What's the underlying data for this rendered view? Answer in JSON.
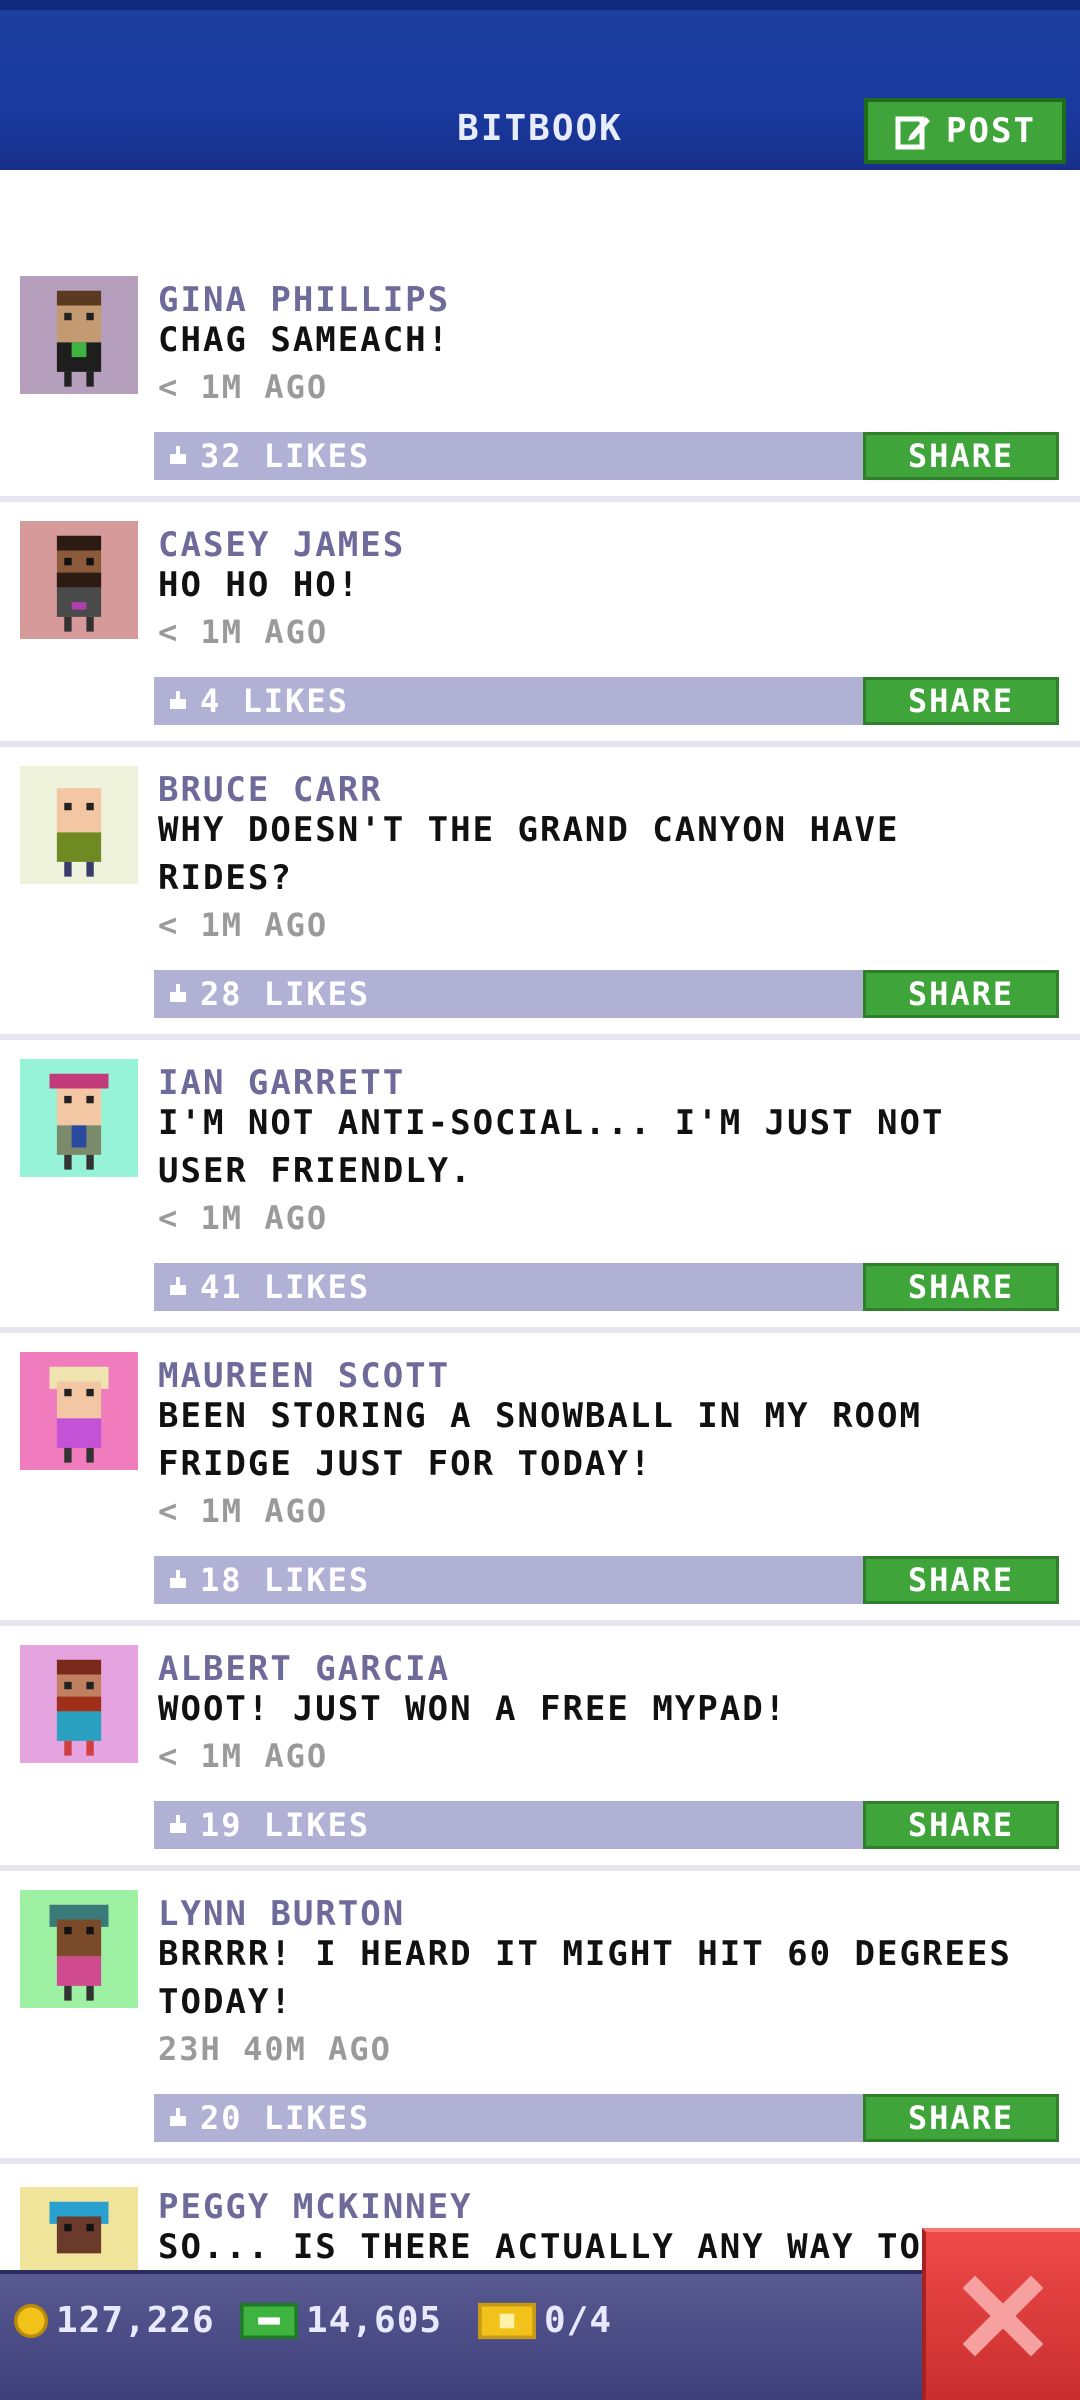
{
  "header": {
    "title": "BITBOOK",
    "post_label": "POST"
  },
  "posts": [
    {
      "name": "GINA PHILLIPS",
      "text": "CHAG SAMEACH!",
      "time": "< 1M AGO",
      "likes": "32 LIKES",
      "share": "SHARE",
      "avatar_bg": "#b59fbd"
    },
    {
      "name": "CASEY JAMES",
      "text": "HO HO HO!",
      "time": "< 1M AGO",
      "likes": "4 LIKES",
      "share": "SHARE",
      "avatar_bg": "#d79a9a"
    },
    {
      "name": "BRUCE CARR",
      "text": "WHY DOESN'T THE GRAND CANYON HAVE RIDES?",
      "time": "< 1M AGO",
      "likes": "28 LIKES",
      "share": "SHARE",
      "avatar_bg": "#eef2db"
    },
    {
      "name": "IAN GARRETT",
      "text": "I'M NOT ANTI-SOCIAL... I'M JUST NOT USER FRIENDLY.",
      "time": "< 1M AGO",
      "likes": "41 LIKES",
      "share": "SHARE",
      "avatar_bg": "#97f3d7"
    },
    {
      "name": "MAUREEN SCOTT",
      "text": "BEEN STORING A SNOWBALL IN MY ROOM FRIDGE JUST FOR TODAY!",
      "time": "< 1M AGO",
      "likes": "18 LIKES",
      "share": "SHARE",
      "avatar_bg": "#f07bbd"
    },
    {
      "name": "ALBERT GARCIA",
      "text": "WOOT! JUST WON A FREE MYPAD!",
      "time": "< 1M AGO",
      "likes": "19 LIKES",
      "share": "SHARE",
      "avatar_bg": "#e5a3e0"
    },
    {
      "name": "LYNN BURTON",
      "text": "BRRRR! I HEARD IT MIGHT HIT 60 DEGREES TODAY!",
      "time": "23H 40M AGO",
      "likes": "20 LIKES",
      "share": "SHARE",
      "avatar_bg": "#9ef0a3"
    },
    {
      "name": "PEGGY MCKINNEY",
      "text": "SO... IS THERE ACTUALLY ANY WAY TO",
      "time": "",
      "likes": "",
      "share": "",
      "avatar_bg": "#f0e49a"
    }
  ],
  "bottom_bar": {
    "coins": "127,226",
    "bux": "14,605",
    "tickets": "0/4"
  },
  "colors": {
    "header_blue": "#1a3aa0",
    "post_green": "#3fa53a",
    "likes_bar": "#b1b1d6",
    "name_purple": "#6e6a9a",
    "close_red": "#d93434"
  }
}
